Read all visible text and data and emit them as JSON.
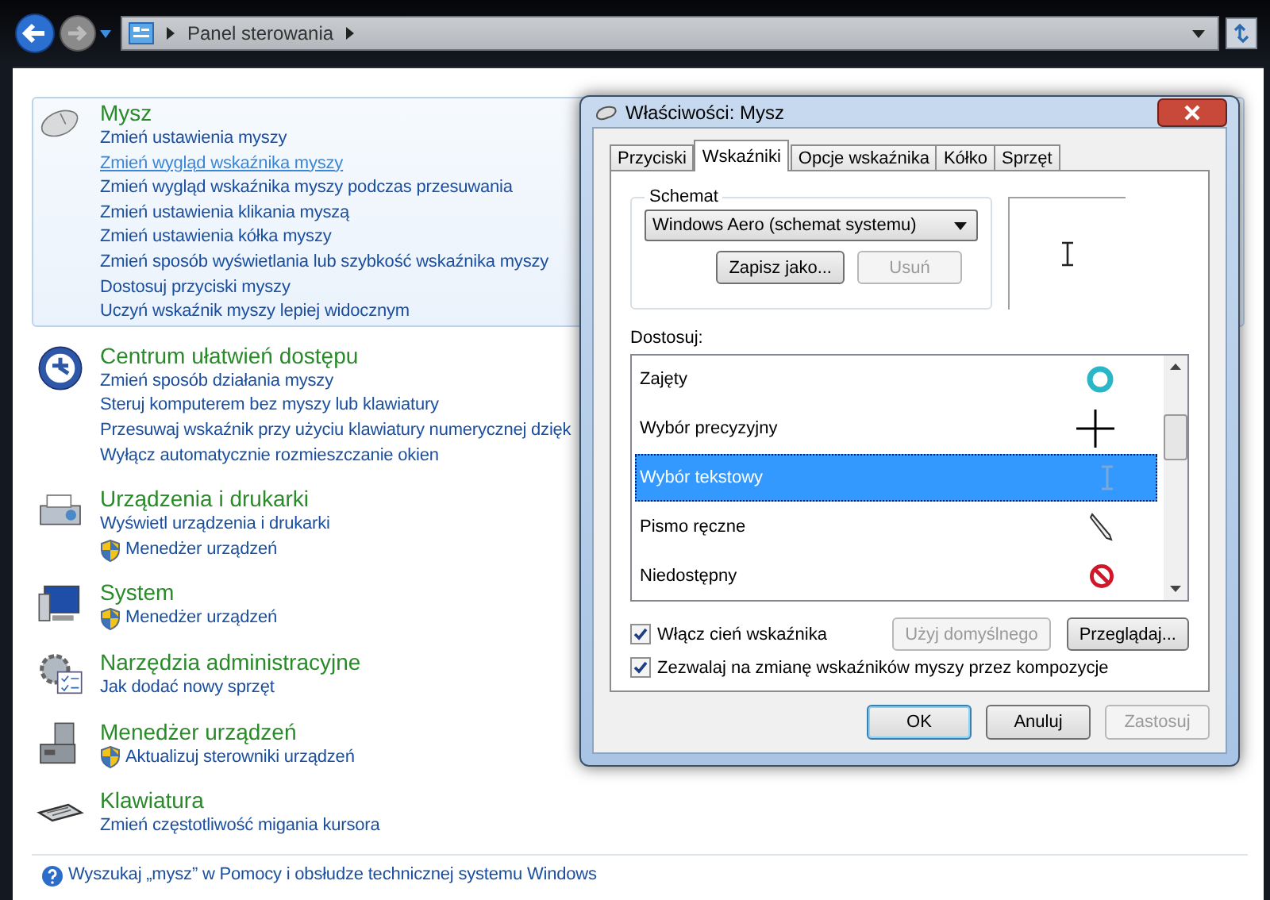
{
  "address": {
    "crumbs": [
      "Panel sterowania"
    ]
  },
  "categories": [
    {
      "kind": "mouse",
      "title": "Mysz",
      "highlighted": true,
      "links": [
        {
          "text": "Zmień ustawienia myszy",
          "shield": false,
          "hovered": false
        },
        {
          "text": "Zmień wygląd wskaźnika myszy",
          "shield": false,
          "hovered": true
        },
        {
          "text": "Zmień wygląd wskaźnika myszy podczas przesuwania",
          "shield": false,
          "hovered": false
        },
        {
          "text": "Zmień ustawienia klikania myszą",
          "shield": false,
          "hovered": false
        },
        {
          "text": "Zmień ustawienia kółka myszy",
          "shield": false,
          "hovered": false
        },
        {
          "text": "Zmień sposób wyświetlania lub szybkość wskaźnika myszy",
          "shield": false,
          "hovered": false
        },
        {
          "text": "Dostosuj przyciski myszy",
          "shield": false,
          "hovered": false
        },
        {
          "text": "Uczyń wskaźnik myszy lepiej widocznym",
          "shield": false,
          "hovered": false
        }
      ]
    },
    {
      "kind": "accessibility",
      "title": "Centrum ułatwień dostępu",
      "highlighted": false,
      "links": [
        {
          "text": "Zmień sposób działania myszy",
          "shield": false,
          "hovered": false
        },
        {
          "text": "Steruj komputerem bez myszy lub klawiatury",
          "shield": false,
          "hovered": false
        },
        {
          "text": "Przesuwaj wskaźnik przy użyciu klawiatury numerycznej dzięk",
          "shield": false,
          "hovered": false
        },
        {
          "text": "Wyłącz automatycznie rozmieszczanie okien",
          "shield": false,
          "hovered": false
        }
      ]
    },
    {
      "kind": "printer",
      "title": "Urządzenia i drukarki",
      "highlighted": false,
      "links": [
        {
          "text": "Wyświetl urządzenia i drukarki",
          "shield": false,
          "hovered": false
        },
        {
          "text": "Menedżer urządzeń",
          "shield": true,
          "hovered": false
        }
      ]
    },
    {
      "kind": "system",
      "title": "System",
      "highlighted": false,
      "links": [
        {
          "text": "Menedżer urządzeń",
          "shield": true,
          "hovered": false
        }
      ]
    },
    {
      "kind": "admin",
      "title": "Narzędzia administracyjne",
      "highlighted": false,
      "links": [
        {
          "text": "Jak dodać nowy sprzęt",
          "shield": false,
          "hovered": false
        }
      ]
    },
    {
      "kind": "devmgr",
      "title": "Menedżer urządzeń",
      "highlighted": false,
      "links": [
        {
          "text": "Aktualizuj sterowniki urządzeń",
          "shield": true,
          "hovered": false
        }
      ]
    },
    {
      "kind": "keyboard",
      "title": "Klawiatura",
      "highlighted": false,
      "links": [
        {
          "text": "Zmień częstotliwość migania kursora",
          "shield": false,
          "hovered": false
        }
      ]
    }
  ],
  "help_link": "Wyszukaj „mysz” w Pomocy i obsłudze technicznej systemu Windows",
  "dialog": {
    "title": "Właściwości: Mysz",
    "tabs": [
      {
        "label": "Przyciski",
        "selected": false
      },
      {
        "label": "Wskaźniki",
        "selected": true
      },
      {
        "label": "Opcje wskaźnika",
        "selected": false
      },
      {
        "label": "Kółko",
        "selected": false
      },
      {
        "label": "Sprzęt",
        "selected": false
      }
    ],
    "scheme": {
      "label": "Schemat",
      "value": "Windows Aero (schemat systemu)",
      "buttons": [
        {
          "label": "Zapisz jako...",
          "disabled": false
        },
        {
          "label": "Usuń",
          "disabled": true
        }
      ]
    },
    "customize_label": "Dostosuj:",
    "cursors": [
      {
        "label": "Zajęty",
        "kind": "busy",
        "selected": false
      },
      {
        "label": "Wybór precyzyjny",
        "kind": "precision",
        "selected": false
      },
      {
        "label": "Wybór tekstowy",
        "kind": "text",
        "selected": true
      },
      {
        "label": "Pismo ręczne",
        "kind": "pen",
        "selected": false
      },
      {
        "label": "Niedostępny",
        "kind": "unavailable",
        "selected": false
      }
    ],
    "shadow": {
      "label": "Włącz cień wskaźnika",
      "checked": true
    },
    "list_buttons": [
      {
        "label": "Użyj domyślnego",
        "disabled": true
      },
      {
        "label": "Przeglądaj...",
        "disabled": false
      }
    ],
    "themes": {
      "label": "Zezwalaj na zmianę wskaźników myszy przez kompozycje",
      "checked": true
    },
    "footer": [
      {
        "label": "OK",
        "disabled": false,
        "default": true
      },
      {
        "label": "Anuluj",
        "disabled": false,
        "default": false
      },
      {
        "label": "Zastosuj",
        "disabled": true,
        "default": false
      }
    ]
  }
}
